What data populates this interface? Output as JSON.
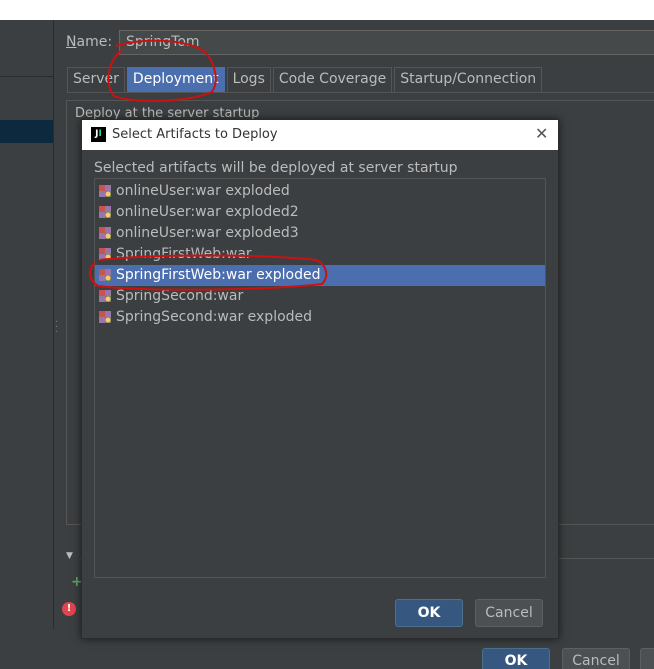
{
  "run_config": {
    "name_label_prefix": "N",
    "name_label_rest": "ame:",
    "name_value": "SpringTom",
    "tabs": [
      {
        "label": "Server",
        "active": false
      },
      {
        "label": "Deployment",
        "active": true
      },
      {
        "label": "Logs",
        "active": false
      },
      {
        "label": "Code Coverage",
        "active": false
      },
      {
        "label": "Startup/Connection",
        "active": false
      }
    ],
    "deploy_text": "Deploy at the server startup"
  },
  "dialog": {
    "title": "Select Artifacts to Deploy",
    "caption": "Selected artifacts will be deployed at server startup",
    "artifacts": [
      {
        "label": "onlineUser:war exploded",
        "selected": false
      },
      {
        "label": "onlineUser:war exploded2",
        "selected": false
      },
      {
        "label": "onlineUser:war exploded3",
        "selected": false
      },
      {
        "label": "SpringFirstWeb:war",
        "selected": false
      },
      {
        "label": "SpringFirstWeb:war exploded",
        "selected": true
      },
      {
        "label": "SpringSecond:war",
        "selected": false
      },
      {
        "label": "SpringSecond:war exploded",
        "selected": false
      }
    ],
    "ok_label": "OK",
    "cancel_label": "Cancel"
  },
  "footer": {
    "ok_label": "OK",
    "cancel_label": "Cancel"
  },
  "icons": {
    "artifact": "artifact-icon",
    "close": "close-icon",
    "error": "error-icon",
    "add": "plus-icon",
    "app": "intellij-icon"
  },
  "colors": {
    "selection": "#4b6eaf",
    "background": "#3c3f41",
    "annotation": "#cc1111"
  }
}
